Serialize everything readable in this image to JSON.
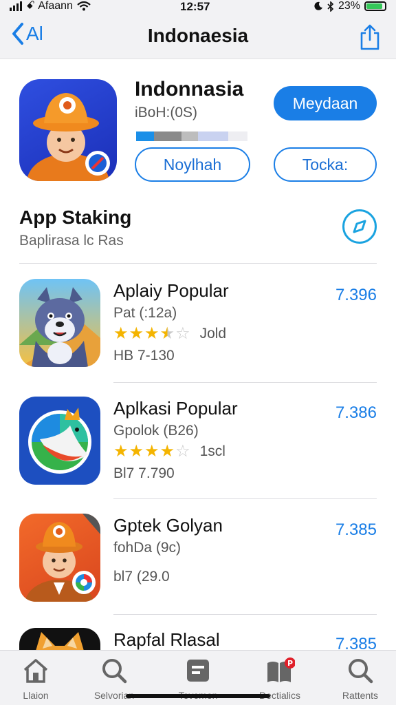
{
  "status_bar": {
    "carrier": "ꗃ Afaann",
    "time": "12:57",
    "battery_text": "23%",
    "battery_level": 0.9
  },
  "nav": {
    "back_label": "Al",
    "title": "Indonaesia"
  },
  "hero": {
    "title": "Indonnasia",
    "subtitle": "iBoH:(0S)",
    "primary_label": "Meydaan",
    "button_a": "Noylhah",
    "button_b": "Tocka:"
  },
  "section": {
    "title": "App Staking",
    "subtitle": "Baplirasa lc Ras"
  },
  "apps": [
    {
      "name": "Aplaiy Popular",
      "developer": "Pat (:12a)",
      "rating": 3.5,
      "rating_text": "Jold",
      "size": "HB 7-130",
      "price": "7.396"
    },
    {
      "name": "Aplkasi Popular",
      "developer": "Gpolok (B26)",
      "rating": 4,
      "rating_text": "1scl",
      "size": "Bl7 7.790",
      "price": "7.386"
    },
    {
      "name": "Gptek Golyan",
      "developer": "fohDa (9c)",
      "rating": 0,
      "rating_text": "",
      "size": "bl7 (29.0",
      "price": "7.385"
    },
    {
      "name": "Rapfal Rlasal",
      "developer": "",
      "rating": 0,
      "rating_text": "",
      "size": "",
      "price": "7.385"
    }
  ],
  "tabs": [
    {
      "label": "Llaion",
      "icon": "home-icon"
    },
    {
      "label": "Selvorian",
      "icon": "search-icon"
    },
    {
      "label": "Tovemon",
      "icon": "card-icon"
    },
    {
      "label": "Dectialics",
      "icon": "book-icon",
      "badge": "P"
    },
    {
      "label": "Rattents",
      "icon": "search-icon"
    }
  ],
  "colors": {
    "accent": "#1a7ee6",
    "star": "#f4b400",
    "bar": "#f2f2f4"
  }
}
